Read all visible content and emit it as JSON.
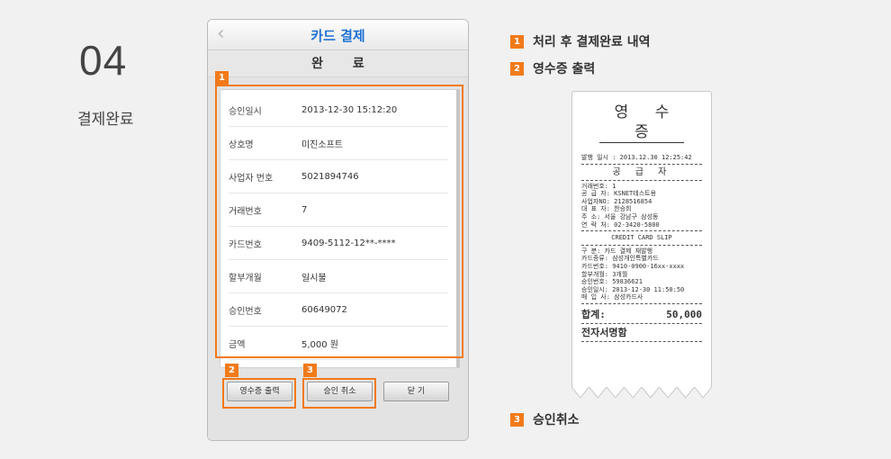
{
  "step": {
    "number": "04",
    "title": "결제완료"
  },
  "phone": {
    "header_title": "카드 결제",
    "subheader": "완 료",
    "rows": [
      {
        "label": "승인일시",
        "value": "2013-12-30 15:12:20"
      },
      {
        "label": "상호명",
        "value": "미진소프트"
      },
      {
        "label": "사업자 번호",
        "value": "5021894746"
      },
      {
        "label": "거래번호",
        "value": "7"
      },
      {
        "label": "카드번호",
        "value": "9409-5112-12**-****"
      },
      {
        "label": "할부개월",
        "value": "일시불"
      },
      {
        "label": "승인번호",
        "value": "60649072"
      },
      {
        "label": "금액",
        "value": "5,000 원"
      }
    ],
    "buttons": {
      "receipt": "영수증 출력",
      "cancel": "승인 취소",
      "close": "닫 기"
    }
  },
  "legend": [
    {
      "num": "1",
      "text": "처리 후 결제완료 내역"
    },
    {
      "num": "2",
      "text": "영수증 출력"
    },
    {
      "num": "3",
      "text": "승인취소"
    }
  ],
  "receipt": {
    "title": "영 수 증",
    "issued": "발행 일시 : 2013.12.30 12:25:42",
    "supplier_heading": "공 급 자",
    "supplier_lines": [
      "거래번호: 1",
      "공 급 자: KSNET테스트용",
      "사업자NO: 2128516854",
      "대 표 자: 한승희",
      "주    소: 서울 강남구 삼성동",
      "연 락 처: 02-3420-5800"
    ],
    "slip_heading": "CREDIT CARD SLIP",
    "slip_lines": [
      "구    분: 카드 결제 재발행",
      "카드종류: 삼성개인특별카드",
      "카드번호: 9410-0900-16xx-xxxx",
      "할부개월: 3개월",
      "승인번호: 59836621",
      "승인일시: 2013-12-30 11:50:50",
      "매 입 사: 삼성카드사"
    ],
    "total_label": "합계:",
    "total_value": "50,000",
    "signature": "전자서명함"
  },
  "colors": {
    "accent": "#f27a1a",
    "header_title": "#1f72d4"
  }
}
